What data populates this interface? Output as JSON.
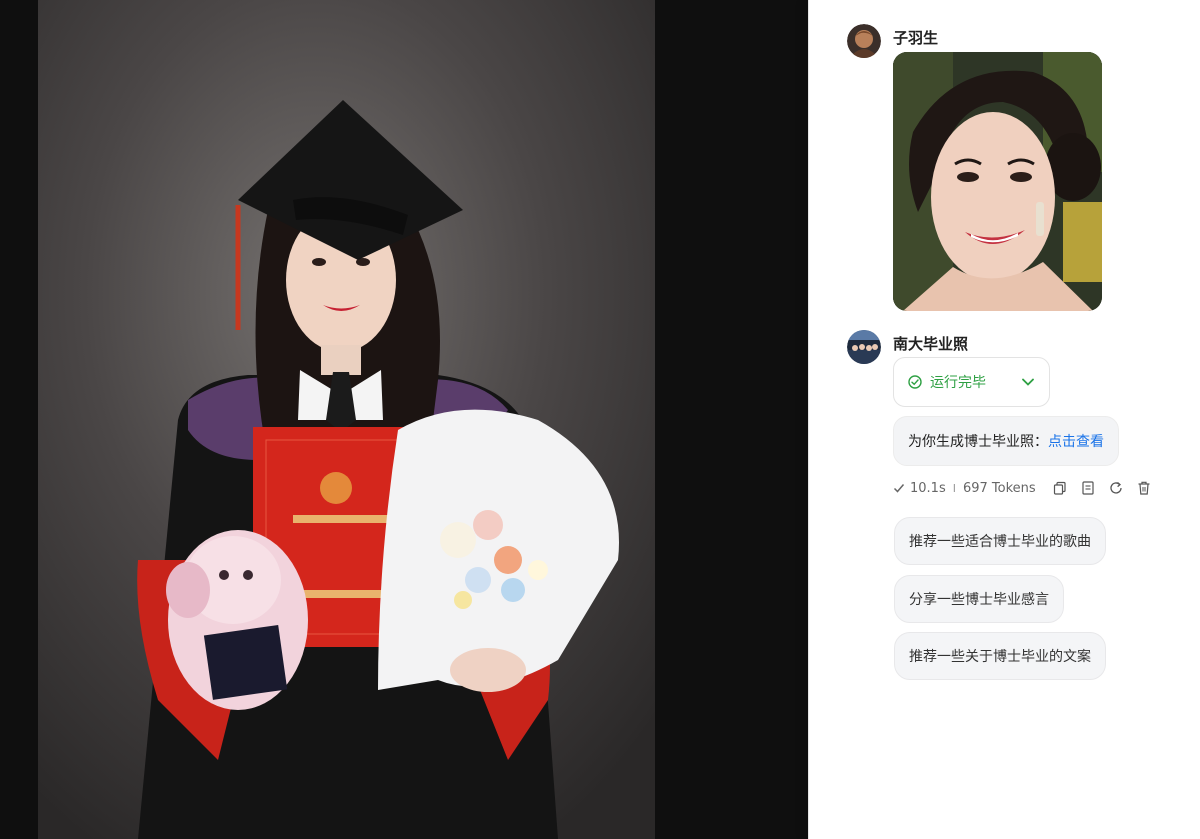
{
  "conversation": {
    "user_message": {
      "sender": "子羽生",
      "attachment_description_icon": "portrait-photo"
    },
    "bot_message": {
      "sender": "南大毕业照",
      "status": "运行完毕",
      "reply_prefix": "为你生成博士毕业照：",
      "reply_link": "点击查看",
      "duration": "10.1s",
      "separator": "I",
      "tokens": "697 Tokens",
      "actions": [
        "copy-icon",
        "note-icon",
        "refresh-icon",
        "delete-icon"
      ]
    },
    "suggestions": [
      "推荐一些适合博士毕业的歌曲",
      "分享一些博士毕业感言",
      "推荐一些关于博士毕业的文案"
    ]
  },
  "colors": {
    "status_green": "#2ea043",
    "link_blue": "#1a73e8",
    "gown_red": "#d4261c"
  }
}
